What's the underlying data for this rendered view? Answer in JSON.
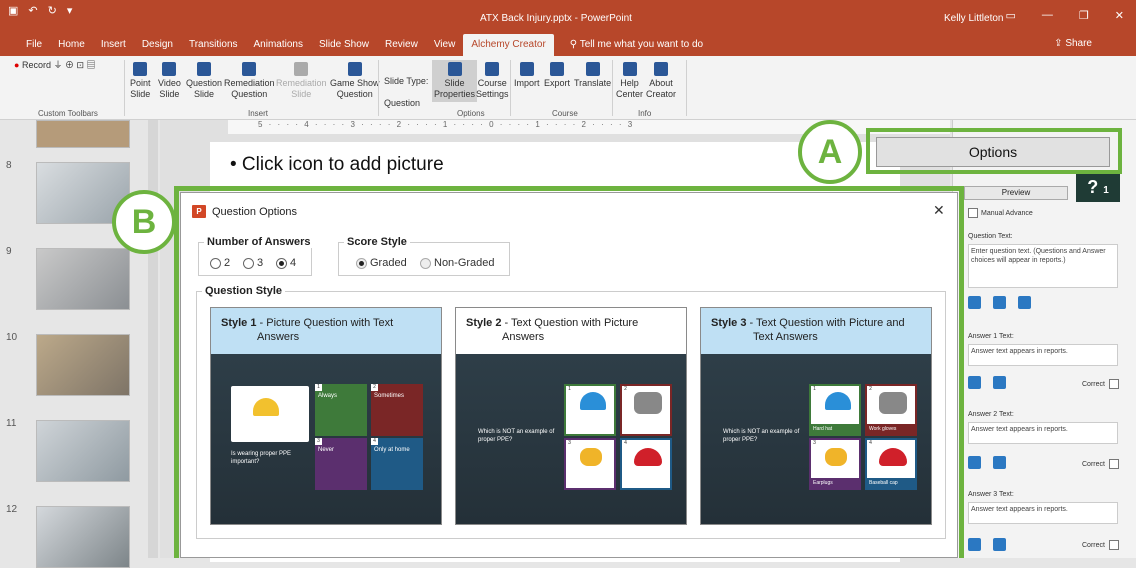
{
  "window": {
    "title": "ATX Back Injury.pptx - PowerPoint",
    "user": "Kelly Littleton",
    "share": "Share",
    "tell_me": "Tell me what you want to do"
  },
  "tabs": [
    "File",
    "Home",
    "Insert",
    "Design",
    "Transitions",
    "Animations",
    "Slide Show",
    "Review",
    "View"
  ],
  "active_tab": "Alchemy Creator",
  "ribbon": {
    "record": "Record",
    "custom_toolbars": "Custom Toolbars",
    "insert_items": [
      {
        "l1": "Point",
        "l2": "Slide"
      },
      {
        "l1": "Video",
        "l2": "Slide"
      },
      {
        "l1": "Question",
        "l2": "Slide"
      },
      {
        "l1": "Remediation",
        "l2": "Question"
      },
      {
        "l1": "Remediation",
        "l2": "Slide"
      },
      {
        "l1": "Game Show",
        "l2": "Question"
      }
    ],
    "insert_group": "Insert",
    "slide_type_label": "Slide Type:",
    "slide_type_value": "Question",
    "options_items": [
      {
        "l1": "Slide",
        "l2": "Properties"
      },
      {
        "l1": "Course",
        "l2": "Settings"
      }
    ],
    "options_group": "Options",
    "course_items": [
      "Import",
      "Export",
      "Translate"
    ],
    "course_group": "Course",
    "info_items": [
      {
        "l1": "Help",
        "l2": "Center"
      },
      {
        "l1": "About",
        "l2": "Creator"
      }
    ],
    "info_group": "Info"
  },
  "slide_numbers": [
    "8",
    "9",
    "10",
    "11",
    "12"
  ],
  "ruler_text": "5 · · · · 4 · · · · 3 · · · · 2 · · · · 1 · · · · 0 · · · · 1 · · · · 2 · · · · 3",
  "slide_bullet": "• Click icon to add picture",
  "callouts": {
    "a": "A",
    "b": "B"
  },
  "options_button": "Options",
  "right_pane": {
    "preview": "Preview",
    "manual_advance": "Manual Advance",
    "question_text_label": "Question Text:",
    "question_placeholder": "Enter question text. (Questions and Answer choices will appear in reports.)",
    "answer1_label": "Answer 1 Text:",
    "answer2_label": "Answer 2 Text:",
    "answer3_label": "Answer 3 Text:",
    "answer_placeholder": "Answer text appears in reports.",
    "correct": "Correct",
    "badge": "1"
  },
  "dialog": {
    "title": "Question Options",
    "close": "✕",
    "num_answers_label": "Number of Answers",
    "num_answers_options": [
      "2",
      "3",
      "4"
    ],
    "num_answers_selected": "4",
    "score_style_label": "Score Style",
    "score_options": [
      "Graded",
      "Non-Graded"
    ],
    "question_style_label": "Question Style",
    "styles": [
      {
        "name": "Style 1",
        "desc": "Picture Question with Text Answers",
        "question": "Is wearing proper PPE important?",
        "answers": [
          "Always",
          "Sometimes",
          "Never",
          "Only at home"
        ]
      },
      {
        "name": "Style 2",
        "desc": "Text Question with Picture Answers",
        "question": "Which is NOT an example of proper PPE?"
      },
      {
        "name": "Style 3",
        "desc": "Text Question with Picture and Text Answers",
        "question": "Which is NOT an example of proper PPE?",
        "answers": [
          "Hard hat",
          "Work gloves",
          "Earplugs",
          "Baseball cap"
        ]
      }
    ]
  }
}
